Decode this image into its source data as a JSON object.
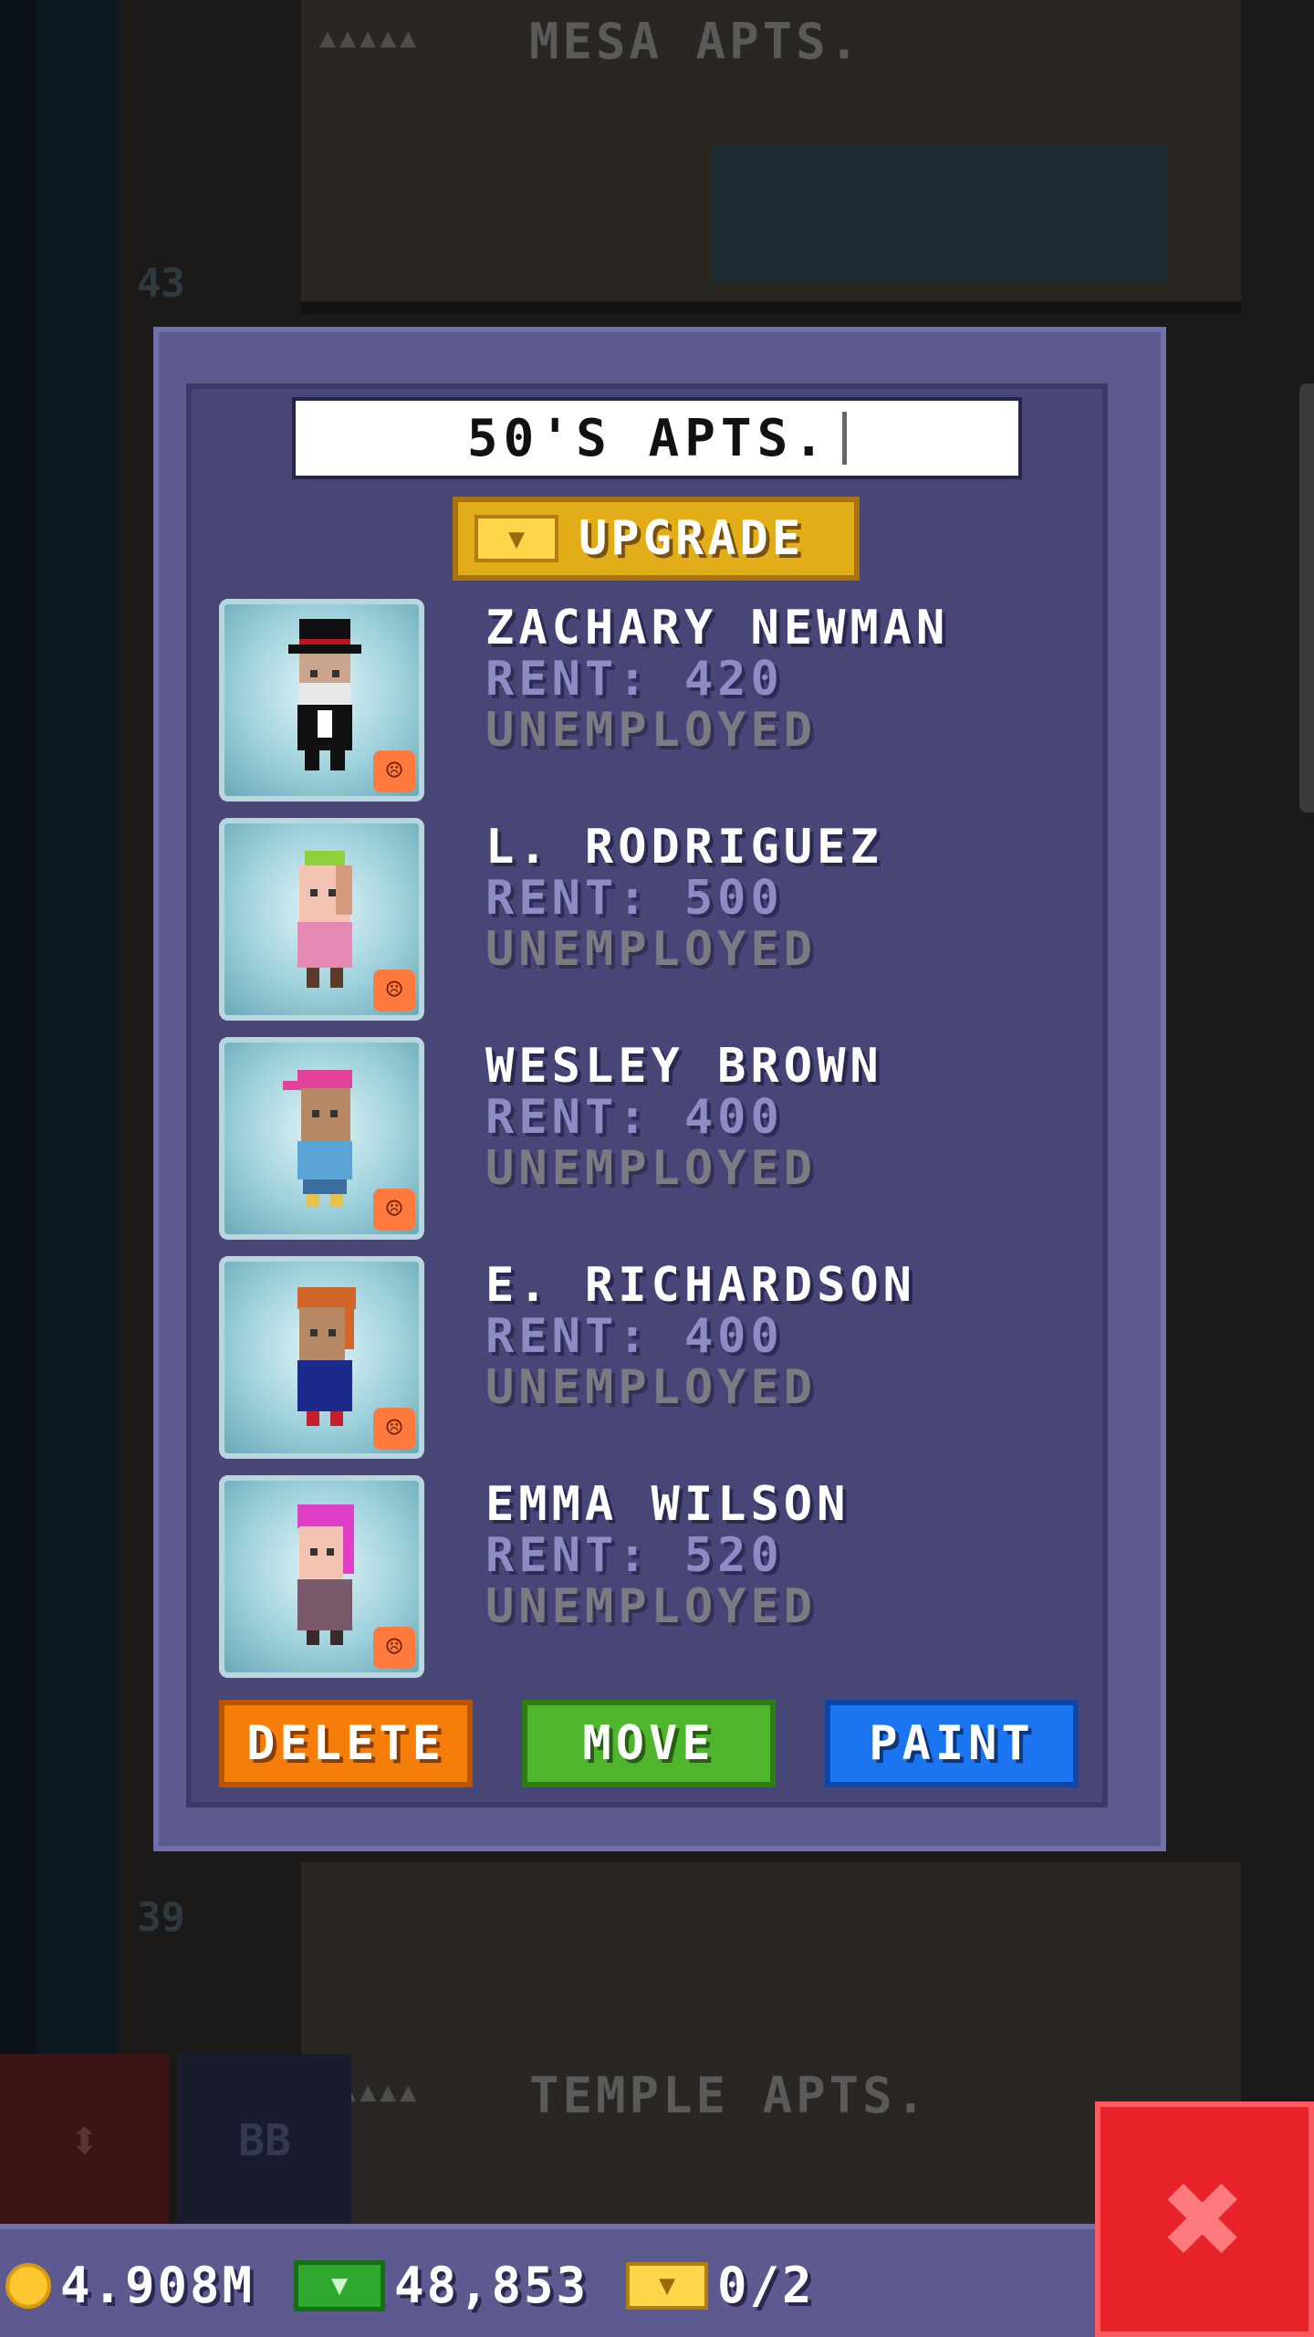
{
  "background": {
    "top_floor": {
      "stars": "▲▲▲▲▲",
      "name": "MESA APTS.",
      "number": "43"
    },
    "lower_floor": {
      "number": "39"
    },
    "bottom_floor": {
      "stars": "▲▲▲▲▲",
      "name": "TEMPLE APTS."
    },
    "side_buttons": {
      "elevator": "⬍",
      "bb": "BB"
    }
  },
  "dialog": {
    "floor_name_value": "50'S APTS.",
    "upgrade_label": "UPGRADE",
    "tenants": [
      {
        "name": "ZACHARY NEWMAN",
        "rent": "RENT: 420",
        "job": "UNEMPLOYED",
        "mood": "sad"
      },
      {
        "name": "L. RODRIGUEZ",
        "rent": "RENT: 500",
        "job": "UNEMPLOYED",
        "mood": "sad"
      },
      {
        "name": "WESLEY BROWN",
        "rent": "RENT: 400",
        "job": "UNEMPLOYED",
        "mood": "sad"
      },
      {
        "name": "E. RICHARDSON",
        "rent": "RENT: 400",
        "job": "UNEMPLOYED",
        "mood": "sad"
      },
      {
        "name": "EMMA WILSON",
        "rent": "RENT: 520",
        "job": "UNEMPLOYED",
        "mood": "sad"
      }
    ],
    "buttons": {
      "delete": "DELETE",
      "move": "MOVE",
      "paint": "PAINT"
    }
  },
  "statusbar": {
    "coins": "4.908M",
    "bux": "48,853",
    "vip": "0/2"
  },
  "colors": {
    "dialog_bg": "#484677",
    "upgrade": "#e3ad1a",
    "delete": "#f57d0a",
    "move": "#4fb52c",
    "paint": "#1b74f0",
    "close": "#e8232a"
  }
}
